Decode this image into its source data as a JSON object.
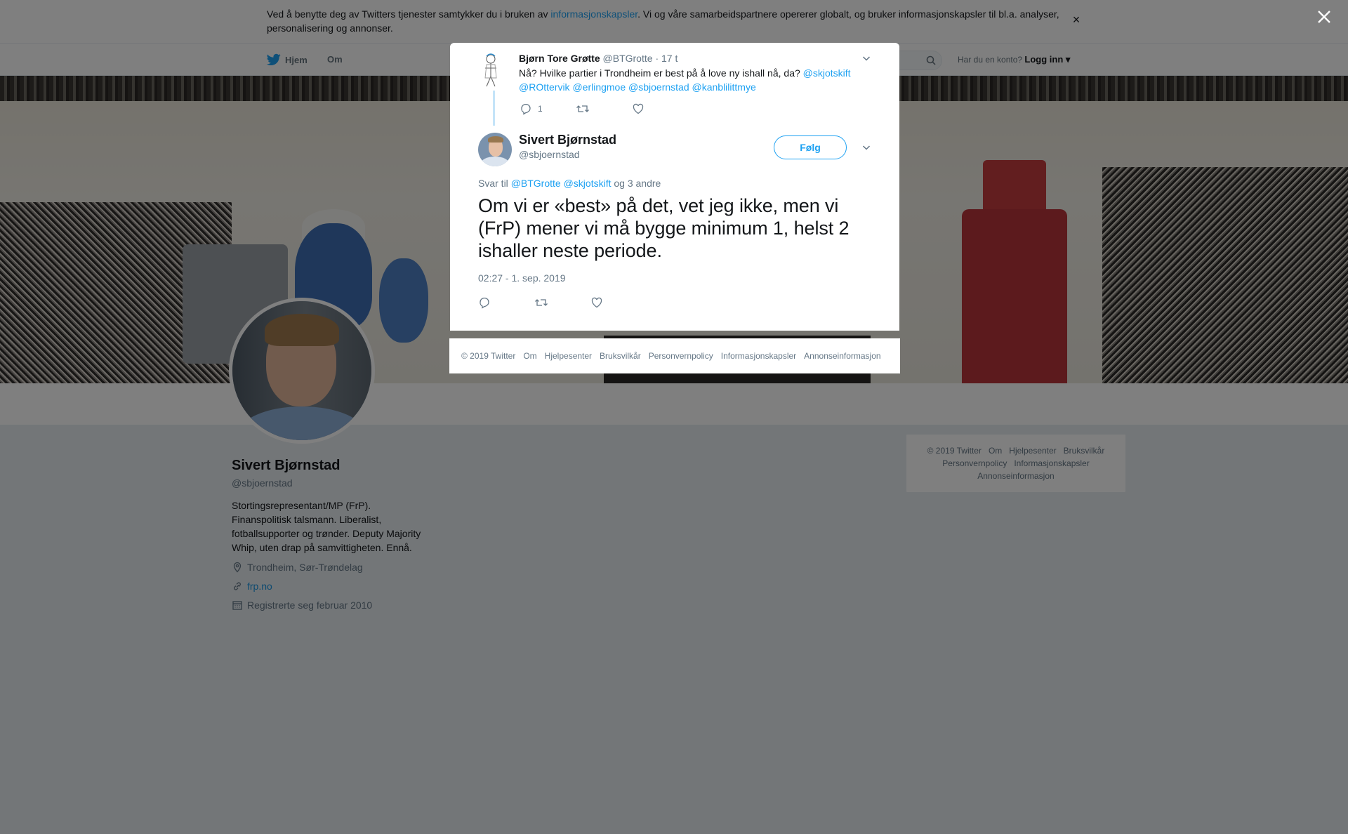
{
  "colors": {
    "accent": "#1da1f2",
    "overlay": "rgba(0,0,0,0.5)",
    "page_bg": "#e6ecf0"
  },
  "cookie_banner": {
    "text_before": "Ved å benytte deg av Twitters tjenester samtykker du i bruken av ",
    "link": "informasjonskapsler",
    "text_after": ". Vi og våre samarbeidspartnere opererer globalt, og bruker informasjonskapsler til bl.a. analyser, personalisering og annonser.",
    "close_icon": "close-icon"
  },
  "nav": {
    "home": "Hjem",
    "about": "Om",
    "account_prompt": "Har du en konto?",
    "login": "Logg inn",
    "icons": {
      "logo": "twitter-bird-icon",
      "search": "search-icon",
      "caret": "caret-down-icon"
    }
  },
  "profile": {
    "name": "Sivert Bjørnstad",
    "handle": "@sbjoernstad",
    "bio": "Stortingsrepresentant/MP (FrP). Finanspolitisk talsmann. Liberalist, fotballsupporter og trønder. Deputy Majority Whip, uten drap på samvittigheten. Ennå.",
    "location": "Trondheim, Sør-Trøndelag",
    "website": "frp.no",
    "joined": "Registrerte seg februar 2010"
  },
  "side_footer": {
    "items_row1": [
      "© 2019 Twitter",
      "Om",
      "Hjelpesenter",
      "Bruksvilkår"
    ],
    "items_row2": [
      "Personvernpolicy",
      "Informasjonskapsler"
    ],
    "items_row3": [
      "Annonseinformasjon"
    ]
  },
  "modal": {
    "parent_tweet": {
      "name": "Bjørn Tore Grøtte",
      "handle": "@BTGrotte",
      "time": "· 17 t",
      "text": "Nå? Hvilke partier i Trondheim er best på å love ny ishall nå, da? ",
      "mentions_line1": "@skjotskift",
      "mentions_line2": "@ROttervik @erlingmoe @sbjoernstad @kanblilittmye",
      "reply_count": "1"
    },
    "main_tweet": {
      "name": "Sivert Bjørnstad",
      "handle": "@sbjoernstad",
      "follow_label": "Følg",
      "reply_prefix": "Svar til ",
      "reply_mentions": "@BTGrotte @skjotskift",
      "reply_suffix": " og 3 andre",
      "text": "Om vi er «best» på det, vet jeg ikke, men vi (FrP) mener vi må bygge minimum 1, helst 2 ishaller neste periode.",
      "timestamp": "02:27 - 1. sep. 2019"
    },
    "footer": [
      "© 2019 Twitter",
      "Om",
      "Hjelpesenter",
      "Bruksvilkår",
      "Personvernpolicy",
      "Informasjonskapsler",
      "Annonseinformasjon"
    ]
  }
}
